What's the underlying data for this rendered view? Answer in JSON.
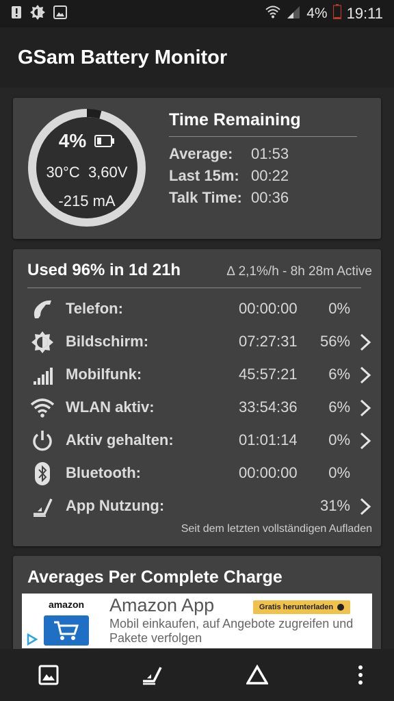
{
  "status_bar": {
    "left_icons": [
      "warning-icon",
      "brightness-icon",
      "image-icon"
    ],
    "battery_percent": "4%",
    "time": "19:11"
  },
  "app_bar": {
    "title": "GSam Battery Monitor"
  },
  "time_card": {
    "gauge": {
      "percent": "4%",
      "temperature": "30°C",
      "voltage": "3,60V",
      "current": "-215 mA",
      "fill_fraction": 0.04
    },
    "title": "Time Remaining",
    "rows": [
      {
        "label": "Average:",
        "value": "01:53"
      },
      {
        "label": "Last 15m:",
        "value": "00:22"
      },
      {
        "label": "Talk Time:",
        "value": "00:36"
      }
    ]
  },
  "usage_card": {
    "title": "Used 96% in 1d 21h",
    "rate": "∆ 2,1%/h - 8h 28m Active",
    "rows": [
      {
        "icon": "phone-icon",
        "label": "Telefon:",
        "time": "00:00:00",
        "percent": "0%",
        "chevron": false
      },
      {
        "icon": "screen-brightness-icon",
        "label": "Bildschirm:",
        "time": "07:27:31",
        "percent": "56%",
        "chevron": true
      },
      {
        "icon": "signal-bars-icon",
        "label": "Mobilfunk:",
        "time": "45:57:21",
        "percent": "6%",
        "chevron": true
      },
      {
        "icon": "wifi-icon",
        "label": "WLAN aktiv:",
        "time": "33:54:36",
        "percent": "6%",
        "chevron": true
      },
      {
        "icon": "power-icon",
        "label": "Aktiv gehalten:",
        "time": "01:01:14",
        "percent": "0%",
        "chevron": true
      },
      {
        "icon": "bluetooth-icon",
        "label": "Bluetooth:",
        "time": "00:00:00",
        "percent": "0%",
        "chevron": false
      },
      {
        "icon": "app-usage-icon",
        "label": "App Nutzung:",
        "time": "",
        "percent": "31%",
        "chevron": true
      }
    ],
    "footer": "Seit dem letzten vollständigen Aufladen"
  },
  "averages_card": {
    "title": "Averages Per Complete Charge"
  },
  "ad": {
    "logo_text": "amazon",
    "title": "Amazon App",
    "button_label": "Gratis herunterladen",
    "description": "Mobil einkaufen, auf Angebote zugreifen und Pakete verfolgen"
  },
  "bottom_bar": {
    "buttons": [
      "image-icon",
      "app-usage-icon",
      "delta-icon",
      "more-vert-icon"
    ]
  },
  "colors": {
    "background": "#262626",
    "card": "#414141",
    "toolbar": "#212121",
    "gauge_track": "#d9d9d9"
  }
}
